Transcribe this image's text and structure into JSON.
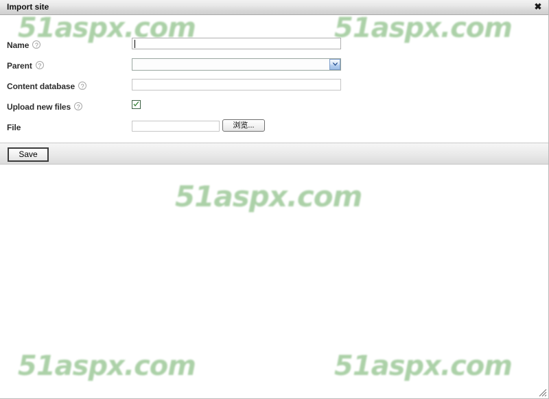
{
  "window": {
    "title": "Import site",
    "close_icon": "close-icon",
    "close_glyph": "✖",
    "resize_grip": "resize-grip-icon"
  },
  "form": {
    "help_glyph": "?",
    "fields": [
      {
        "id": "name",
        "label": "Name",
        "has_help": true,
        "type": "text",
        "value": "",
        "placeholder": "",
        "focused": true
      },
      {
        "id": "parent",
        "label": "Parent",
        "has_help": true,
        "type": "select",
        "value": "",
        "dropdown_icon": "chevron-down-icon"
      },
      {
        "id": "content-database",
        "label": "Content database",
        "has_help": true,
        "type": "text",
        "value": "",
        "placeholder": "",
        "focused": false
      },
      {
        "id": "upload-new-files",
        "label": "Upload new files",
        "has_help": true,
        "type": "checkbox",
        "checked": true,
        "check_icon": "checkmark-icon"
      },
      {
        "id": "file",
        "label": "File",
        "has_help": false,
        "type": "file",
        "value": "",
        "placeholder": "",
        "browse_label": "浏览..."
      }
    ]
  },
  "footer": {
    "save_label": "Save"
  },
  "watermarks": {
    "text": "51aspx.com",
    "color": "#a8cfa4"
  }
}
